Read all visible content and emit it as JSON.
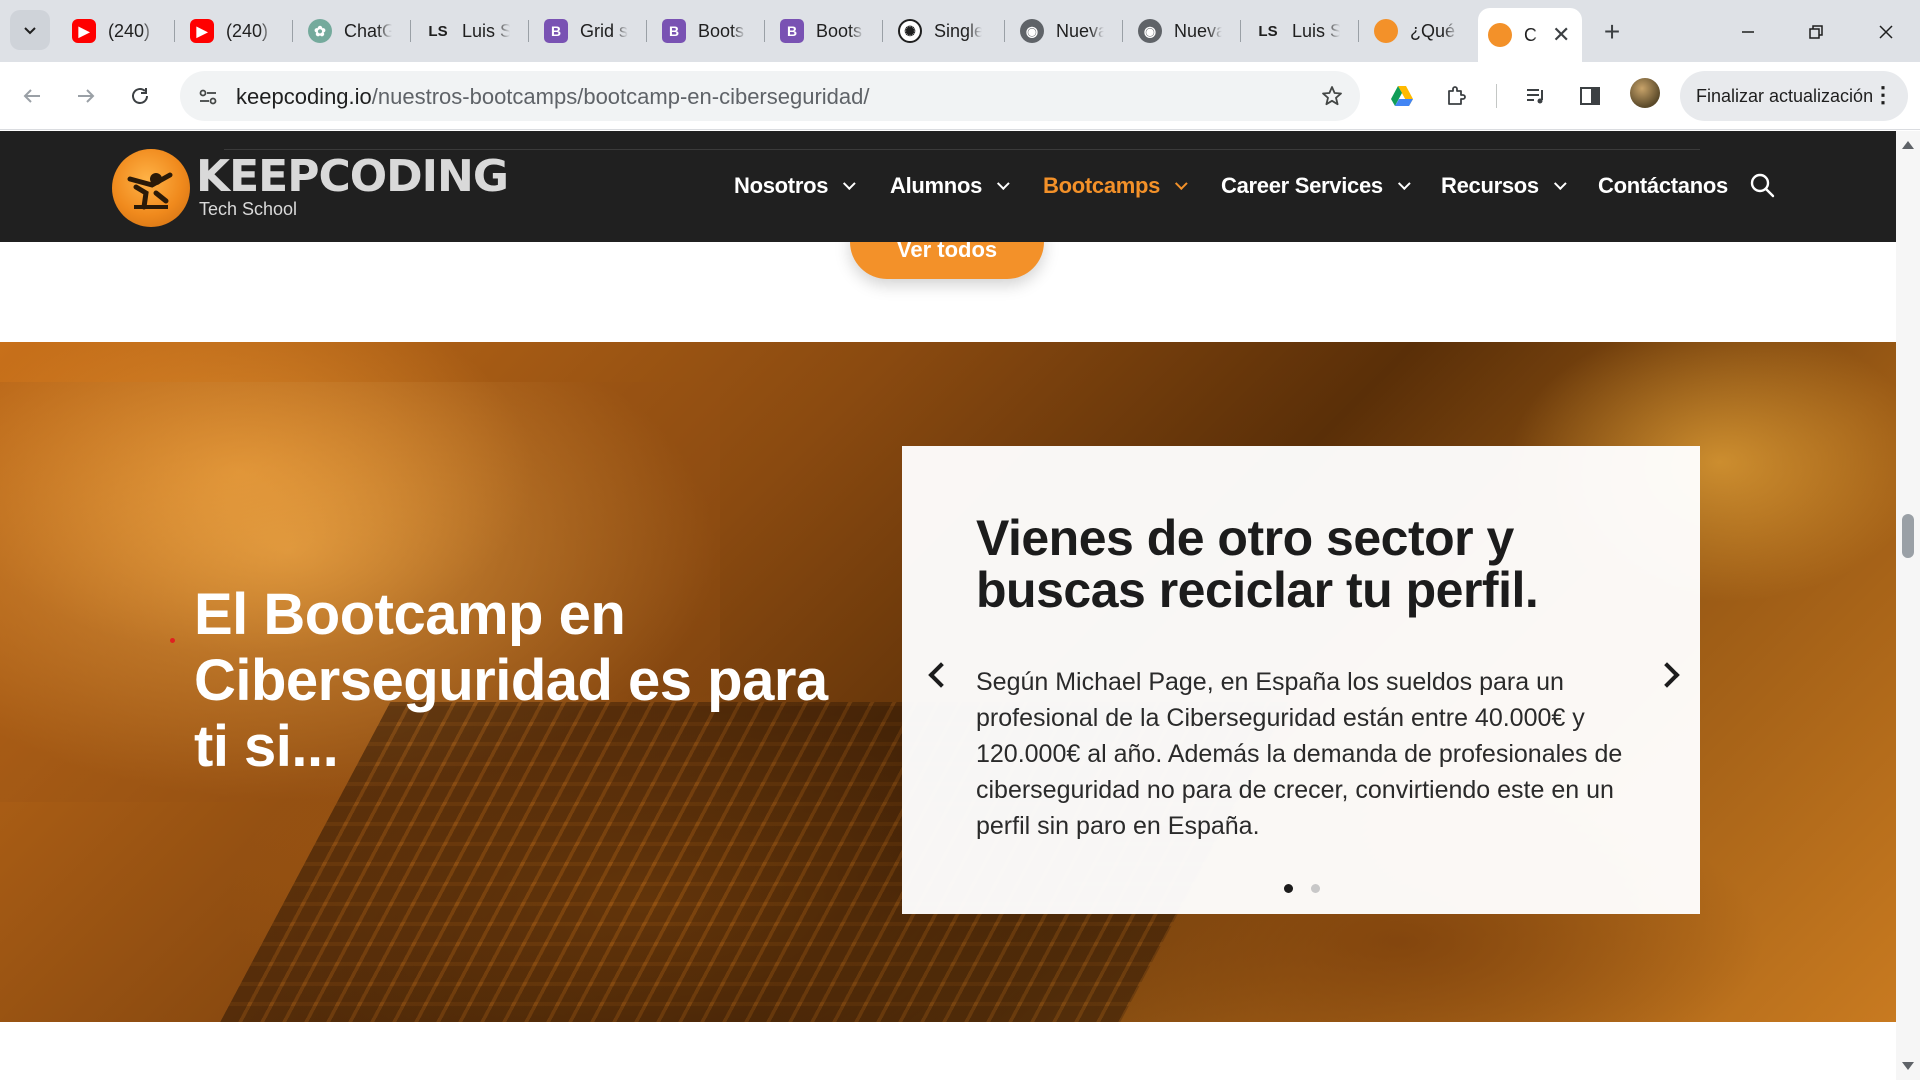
{
  "browser": {
    "tabs": [
      {
        "title": "(240)",
        "favicon": "youtube-icon",
        "color": "#ff0000"
      },
      {
        "title": "(240)",
        "favicon": "youtube-icon",
        "color": "#ff0000"
      },
      {
        "title": "ChatG",
        "favicon": "chatgpt-icon",
        "color": "#74aa9c"
      },
      {
        "title": "Luis S",
        "favicon": "ls-icon",
        "color": "#1f1f1f"
      },
      {
        "title": "Grid s",
        "favicon": "bootstrap-icon",
        "color": "#7952b3"
      },
      {
        "title": "Boots",
        "favicon": "bootstrap-icon",
        "color": "#7952b3"
      },
      {
        "title": "Boots",
        "favicon": "bootstrap-icon",
        "color": "#7952b3"
      },
      {
        "title": "Single",
        "favicon": "openai-icon",
        "color": "#1f1f1f"
      },
      {
        "title": "Nueva",
        "favicon": "chrome-icon",
        "color": "#5f6368"
      },
      {
        "title": "Nueva",
        "favicon": "chrome-icon",
        "color": "#5f6368"
      },
      {
        "title": "Luis S",
        "favicon": "ls-icon",
        "color": "#1f1f1f"
      },
      {
        "title": "¿Qué",
        "favicon": "keepcoding-icon",
        "color": "#f39129"
      },
      {
        "title": "C",
        "favicon": "keepcoding-icon",
        "color": "#f39129",
        "active": true
      }
    ],
    "url_host": "keepcoding.io",
    "url_path": "/nuestros-bootcamps/bootcamp-en-ciberseguridad/",
    "update_button": "Finalizar actualización"
  },
  "site": {
    "logo_name": "KEEPCODING",
    "logo_tagline": "Tech School",
    "nav": [
      {
        "label": "Nosotros",
        "has_menu": true
      },
      {
        "label": "Alumnos",
        "has_menu": true
      },
      {
        "label": "Bootcamps",
        "has_menu": true,
        "active": true
      },
      {
        "label": "Career Services",
        "has_menu": true
      },
      {
        "label": "Recursos",
        "has_menu": true
      },
      {
        "label": "Contáctanos",
        "has_menu": false
      }
    ],
    "accent_color": "#f39129",
    "ver_todos_label": "Ver todos"
  },
  "hero": {
    "title": "El Bootcamp en Ciberseguridad es para ti si...",
    "card": {
      "title": "Vienes de otro sector y buscas reciclar tu perfil.",
      "text": "Según Michael Page, en España los sueldos para un profesional de la Ciberseguridad están entre 40.000€ y 120.000€ al año. Además la demanda de profesionales de ciberseguridad no para de crecer, convirtiendo este en un perfil sin paro en España.",
      "slide_count": 2,
      "active_slide": 1
    }
  }
}
